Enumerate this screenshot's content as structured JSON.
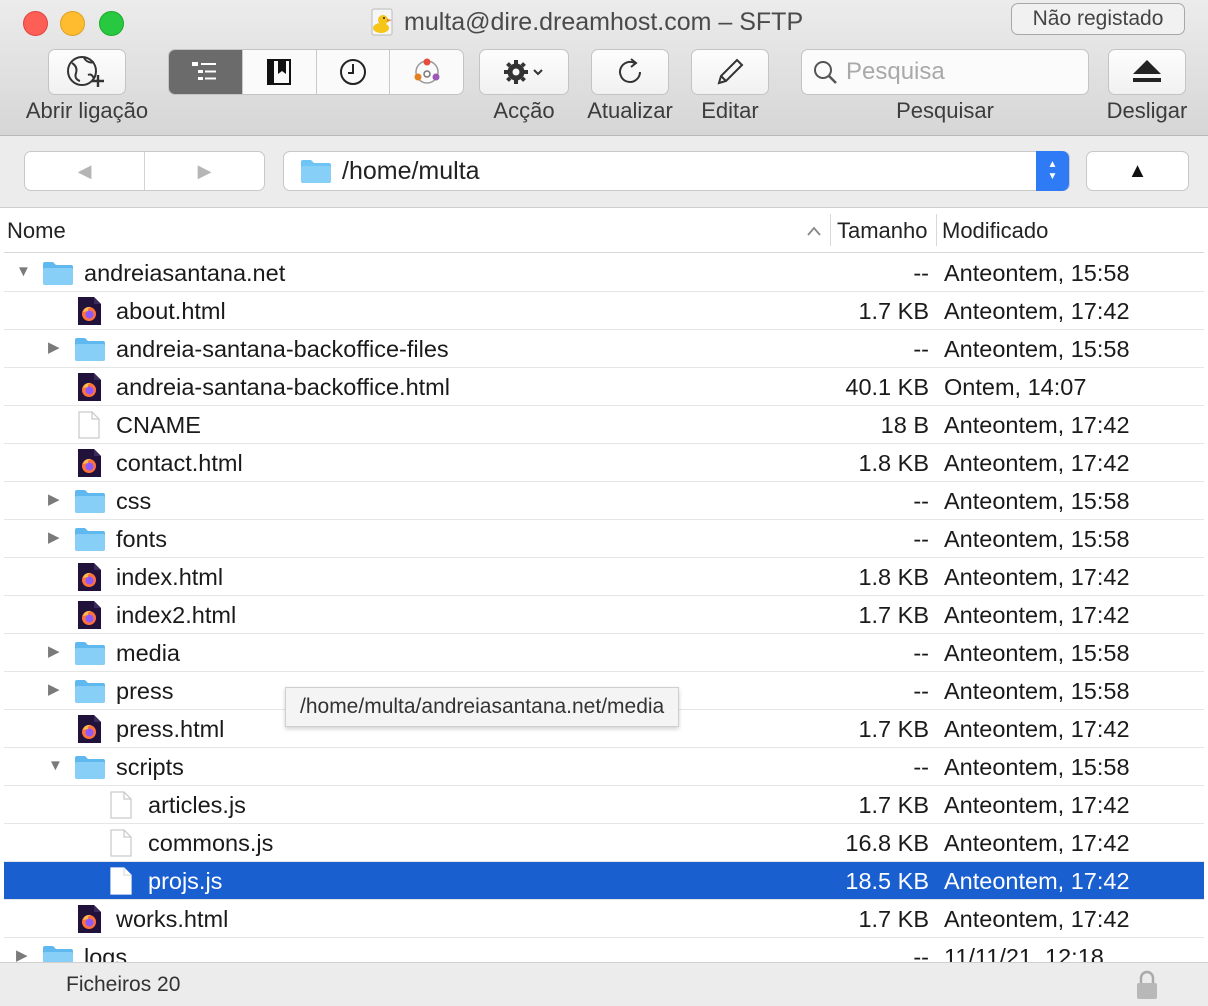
{
  "window": {
    "title": "multa@dire.dreamhost.com – SFTP",
    "registration_button": "Não registado"
  },
  "toolbar": {
    "open_connection": "Abrir ligação",
    "action": "Acção",
    "refresh": "Atualizar",
    "edit": "Editar",
    "search_label": "Pesquisar",
    "search_placeholder": "Pesquisa",
    "disconnect": "Desligar",
    "view_segments": [
      "outline-view-icon",
      "bookmarks-icon",
      "history-icon",
      "bonjour-icon"
    ],
    "accent": "#6b6b6b"
  },
  "navigation": {
    "path": "/home/multa",
    "back_icon": "◀",
    "forward_icon": "▶",
    "up_icon": "▲"
  },
  "columns": {
    "name": "Nome",
    "size": "Tamanho",
    "modified": "Modificado"
  },
  "tooltip": "/home/multa/andreiasantana.net/media",
  "rows": [
    {
      "name": "andreiasantana.net",
      "size": "--",
      "modified": "Anteontem, 15:58",
      "type": "folder",
      "depth": 0,
      "disclosure": "expanded"
    },
    {
      "name": "about.html",
      "size": "1.7 KB",
      "modified": "Anteontem, 17:42",
      "type": "html",
      "depth": 1,
      "disclosure": "none"
    },
    {
      "name": "andreia-santana-backoffice-files",
      "size": "--",
      "modified": "Anteontem, 15:58",
      "type": "folder",
      "depth": 1,
      "disclosure": "collapsed"
    },
    {
      "name": "andreia-santana-backoffice.html",
      "size": "40.1 KB",
      "modified": "Ontem, 14:07",
      "type": "html",
      "depth": 1,
      "disclosure": "none"
    },
    {
      "name": "CNAME",
      "size": "18 B",
      "modified": "Anteontem, 17:42",
      "type": "file",
      "depth": 1,
      "disclosure": "none"
    },
    {
      "name": "contact.html",
      "size": "1.8 KB",
      "modified": "Anteontem, 17:42",
      "type": "html",
      "depth": 1,
      "disclosure": "none"
    },
    {
      "name": "css",
      "size": "--",
      "modified": "Anteontem, 15:58",
      "type": "folder",
      "depth": 1,
      "disclosure": "collapsed"
    },
    {
      "name": "fonts",
      "size": "--",
      "modified": "Anteontem, 15:58",
      "type": "folder",
      "depth": 1,
      "disclosure": "collapsed"
    },
    {
      "name": "index.html",
      "size": "1.8 KB",
      "modified": "Anteontem, 17:42",
      "type": "html",
      "depth": 1,
      "disclosure": "none"
    },
    {
      "name": "index2.html",
      "size": "1.7 KB",
      "modified": "Anteontem, 17:42",
      "type": "html",
      "depth": 1,
      "disclosure": "none"
    },
    {
      "name": "media",
      "size": "--",
      "modified": "Anteontem, 15:58",
      "type": "folder",
      "depth": 1,
      "disclosure": "collapsed"
    },
    {
      "name": "press",
      "size": "--",
      "modified": "Anteontem, 15:58",
      "type": "folder",
      "depth": 1,
      "disclosure": "collapsed"
    },
    {
      "name": "press.html",
      "size": "1.7 KB",
      "modified": "Anteontem, 17:42",
      "type": "html",
      "depth": 1,
      "disclosure": "none"
    },
    {
      "name": "scripts",
      "size": "--",
      "modified": "Anteontem, 15:58",
      "type": "folder",
      "depth": 1,
      "disclosure": "expanded"
    },
    {
      "name": "articles.js",
      "size": "1.7 KB",
      "modified": "Anteontem, 17:42",
      "type": "file",
      "depth": 2,
      "disclosure": "none"
    },
    {
      "name": "commons.js",
      "size": "16.8 KB",
      "modified": "Anteontem, 17:42",
      "type": "file",
      "depth": 2,
      "disclosure": "none"
    },
    {
      "name": "projs.js",
      "size": "18.5 KB",
      "modified": "Anteontem, 17:42",
      "type": "file",
      "depth": 2,
      "disclosure": "none",
      "selected": true
    },
    {
      "name": "works.html",
      "size": "1.7 KB",
      "modified": "Anteontem, 17:42",
      "type": "html",
      "depth": 1,
      "disclosure": "none"
    },
    {
      "name": "logs",
      "size": "--",
      "modified": "11/11/21, 12:18",
      "type": "folder",
      "depth": 0,
      "disclosure": "collapsed"
    }
  ],
  "status": {
    "file_count": "Ficheiros 20"
  },
  "colors": {
    "selection": "#1a5fd0",
    "folder": "#6ec4f5",
    "stepper": "#2f7bf6"
  }
}
